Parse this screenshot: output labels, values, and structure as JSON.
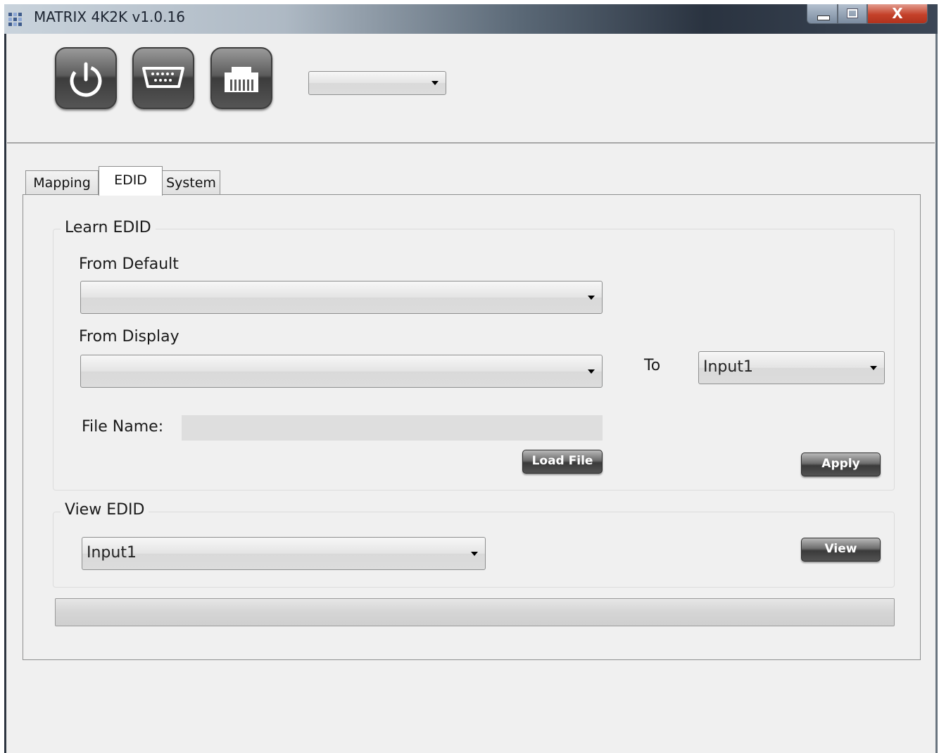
{
  "window": {
    "title": "MATRIX 4K2K v1.0.16",
    "close_label": "X"
  },
  "toolbar": {
    "power_icon": "power-icon",
    "serial_icon": "serial-port-icon",
    "network_icon": "network-port-icon",
    "port_select": {
      "value": ""
    }
  },
  "tabs": [
    {
      "label": "Mapping",
      "active": false
    },
    {
      "label": "EDID",
      "active": true
    },
    {
      "label": "System",
      "active": false
    }
  ],
  "learn_edid": {
    "title": "Learn EDID",
    "from_default_label": "From Default",
    "from_default_value": "",
    "from_display_label": "From Display",
    "from_display_value": "",
    "to_label": "To",
    "to_value": "Input1",
    "file_name_label": "File Name:",
    "file_name_value": "",
    "load_file_label": "Load File",
    "apply_label": "Apply"
  },
  "view_edid": {
    "title": "View EDID",
    "input_value": "Input1",
    "view_label": "View"
  },
  "status": {
    "progress": 0
  }
}
